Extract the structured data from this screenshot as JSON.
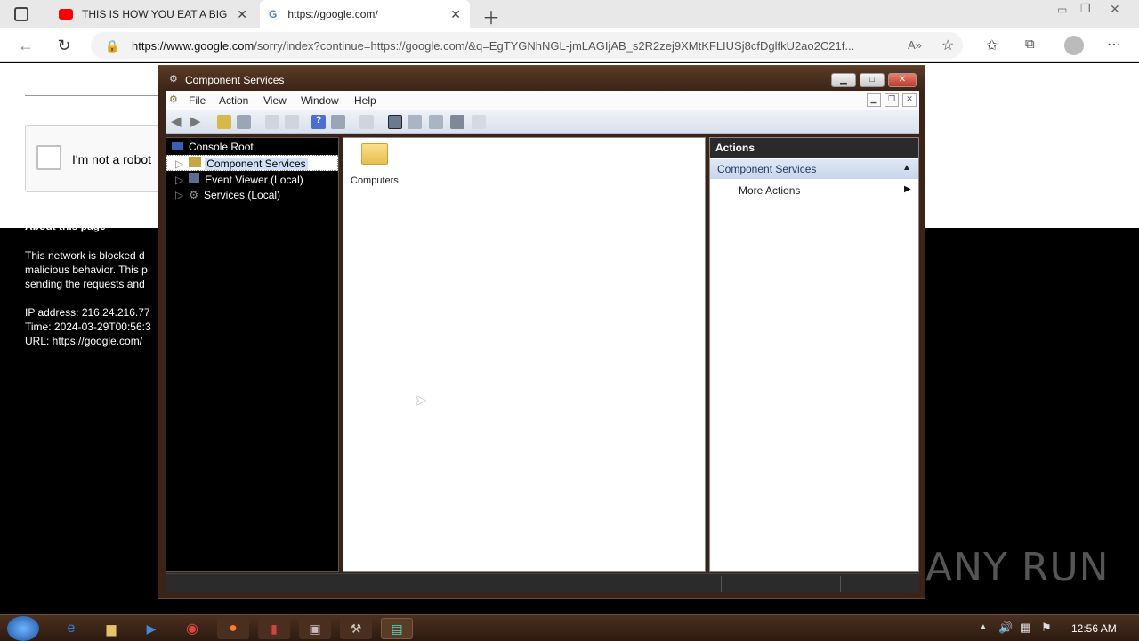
{
  "browser": {
    "tabs": [
      {
        "label": "THIS IS HOW YOU EAT A BIG M",
        "icon": "youtube-icon"
      },
      {
        "label": "https://google.com/",
        "icon": "google-icon"
      }
    ],
    "url_host": "https://www.google.com",
    "url_path": "/sorry/index?continue=https://google.com/&q=EgTYGNhNGL-jmLAGIjAB_s2R2zej9XMtKFLIUSj8cfDglfkU2ao2C21f..."
  },
  "page": {
    "captcha_label": "I'm not a robot",
    "about_heading": "About this page",
    "lines": [
      "This network is blocked d",
      "malicious behavior. This p",
      "sending the requests and"
    ],
    "ip": "IP address: 216.24.216.77",
    "time": "Time: 2024-03-29T00:56:3",
    "url": "URL: https://google.com/"
  },
  "window": {
    "title": "Component Services",
    "menus": [
      "File",
      "Action",
      "View",
      "Window",
      "Help"
    ],
    "tree": {
      "root": "Console Root",
      "items": [
        "Component Services",
        "Event Viewer (Local)",
        "Services (Local)"
      ]
    },
    "center_item": "Computers",
    "actions": {
      "header": "Actions",
      "section": "Component Services",
      "more": "More Actions"
    }
  },
  "taskbar": {
    "clock": "12:56 AM"
  },
  "watermark": "ANY RUN"
}
